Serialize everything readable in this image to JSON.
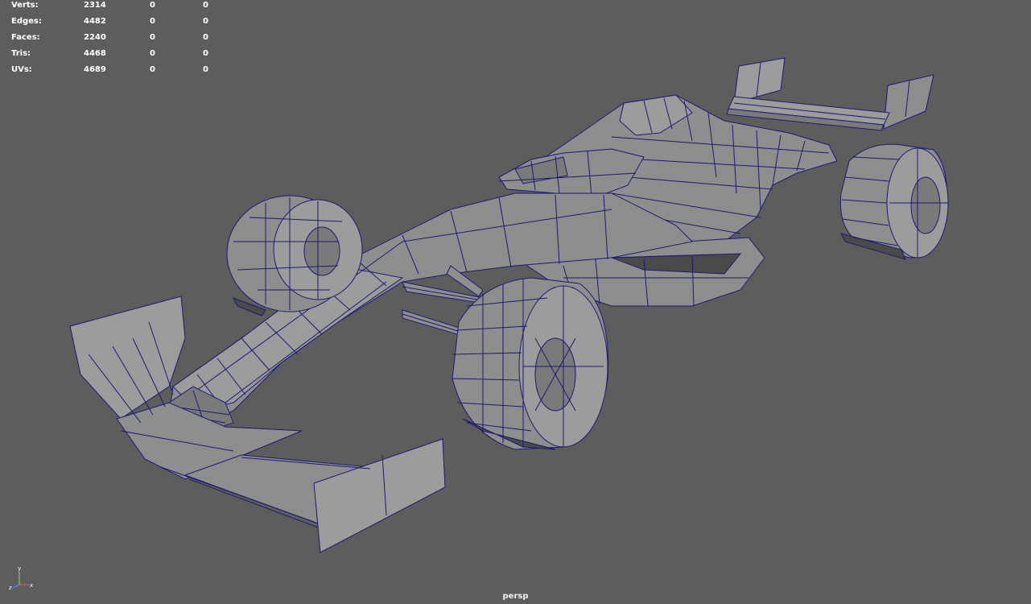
{
  "hud": {
    "rows": [
      {
        "label": "Verts:",
        "v1": "2314",
        "v2": "0",
        "v3": "0"
      },
      {
        "label": "Edges:",
        "v1": "4482",
        "v2": "0",
        "v3": "0"
      },
      {
        "label": "Faces:",
        "v1": "2240",
        "v2": "0",
        "v3": "0"
      },
      {
        "label": "Tris:",
        "v1": "4468",
        "v2": "0",
        "v3": "0"
      },
      {
        "label": "UVs:",
        "v1": "4689",
        "v2": "0",
        "v3": "0"
      }
    ]
  },
  "viewport": {
    "camera": "persp",
    "background_color": "#5d5d5d",
    "wire_color": "#1a1a6e",
    "shaded_color": "#8f8f8f"
  },
  "gizmo": {
    "y_label": "y",
    "z_label": "z",
    "x_label": "x",
    "icon": "axis-gizmo-icon"
  }
}
